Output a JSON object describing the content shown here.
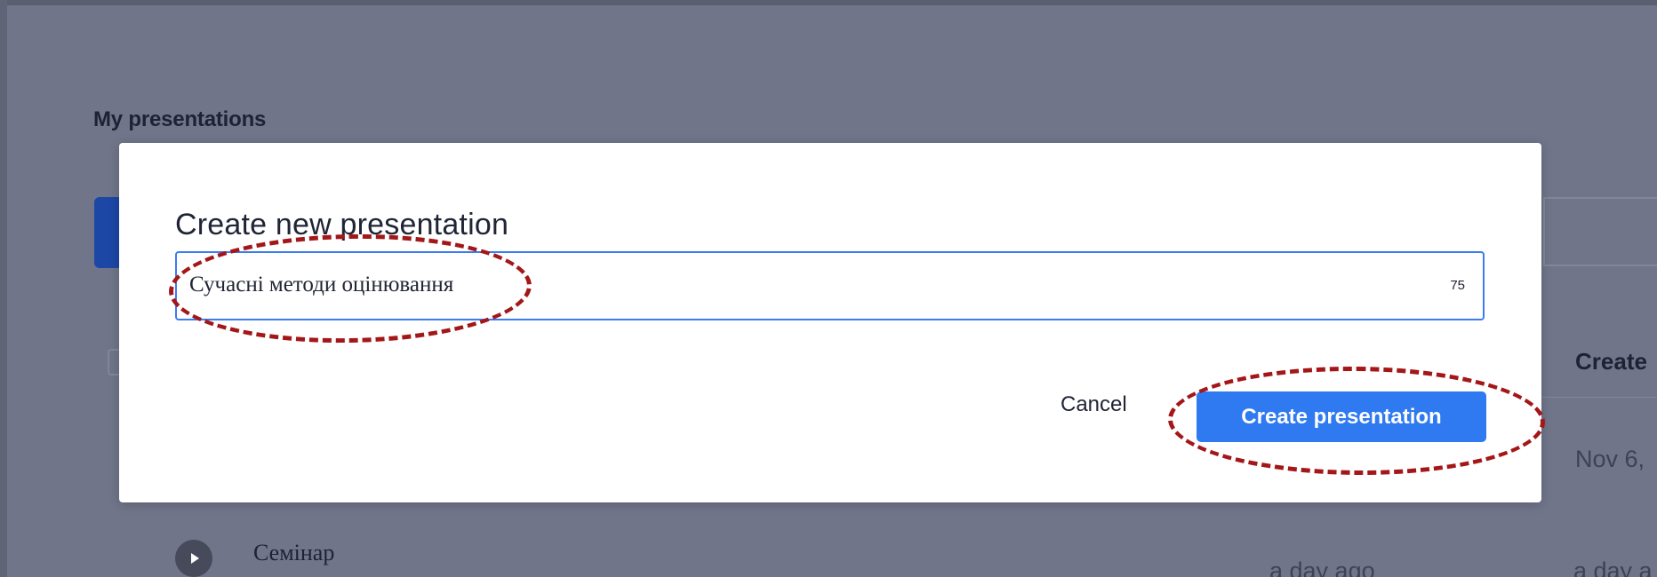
{
  "background": {
    "section_title": "My presentations",
    "column_header": "Create",
    "date_text": "Nov 6,",
    "row_title": "Семінар",
    "time_updated": "a day ago",
    "time_created": "a day a"
  },
  "dialog": {
    "title": "Create new presentation",
    "name_value": "Сучасні методи оцінювання",
    "char_remaining": "75",
    "cancel_label": "Cancel",
    "create_label": "Create presentation"
  },
  "icons": {
    "play": "play-icon"
  },
  "colors": {
    "overlay": "#70758a",
    "primary_button": "#2f7af0",
    "focus_border": "#3b7cf0",
    "annotation": "#a31719",
    "bg_accent": "#1d47a5"
  }
}
